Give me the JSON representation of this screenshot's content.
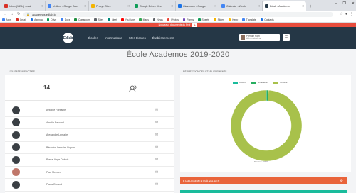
{
  "browser": {
    "tabs": [
      {
        "title": "Inbox (1,234) - mail",
        "color": "#d93025"
      },
      {
        "title": "Untitled - Google Docs",
        "color": "#4285f4"
      },
      {
        "title": "Proxy - Sites",
        "color": "#f4b400"
      },
      {
        "title": "Google Drive - files",
        "color": "#0f9d58"
      },
      {
        "title": "Classroom - Google",
        "color": "#1a73e8"
      },
      {
        "title": "Calendar - Week",
        "color": "#4285f4"
      },
      {
        "title": "Edlab - Academos",
        "color": "#253746"
      }
    ],
    "active_tab": 6,
    "new_tab_label": "+",
    "window_controls": [
      "–",
      "❐",
      "✕"
    ],
    "url": "academos.edlab.io",
    "bookmarks": [
      "Apps",
      "Gmail",
      "Agenda",
      "Drive",
      "Docs",
      "Classroom",
      "Sites",
      "Meet",
      "YouTube",
      "Maps",
      "News",
      "Photos",
      "Forms",
      "Sheets",
      "Slides",
      "Keep",
      "Translate",
      "Contacts"
    ]
  },
  "banner": {
    "text": "Nouveaux documents du Prof",
    "button": "+"
  },
  "app": {
    "logo": "Edlab",
    "nav": [
      "Écoles",
      "Informations",
      "Mes Écoles",
      "Établissements"
    ],
    "user_name": "Prénom Nom",
    "user_role": "Administrateur",
    "menu_icon": "☰"
  },
  "page_title": "École Academos 2019-2020",
  "left": {
    "section_label": "UTILISATEURS ACTIFS",
    "stat_value": "14",
    "users": [
      "Antoine Fontaine",
      "Amélie Bernard",
      "Alexandre Lemaire",
      "Bérénice Lemaire-Dupont",
      "Pierre-Ange Dubois",
      "Paul Mercier",
      "Paula Durand"
    ],
    "row_icon": "✉"
  },
  "right": {
    "section_label": "RÉPARTITION DES ÉTABLISSEMENTS",
    "legend": [
      {
        "label": "Ouvert",
        "color": "#1abc9c"
      },
      {
        "label": "En attente",
        "color": "#27ae60"
      },
      {
        "label": "Terminé",
        "color": "#a8c14b"
      }
    ],
    "caption": "Terminé: 100%",
    "orange_bar": "ÉTABLISSEMENTS À VALIDER",
    "orange_icon": "⚙"
  },
  "chart_data": {
    "type": "pie",
    "style": "donut",
    "categories": [
      "Ouvert",
      "En attente",
      "Terminé"
    ],
    "values": [
      0,
      1,
      99
    ],
    "colors": [
      "#1abc9c",
      "#27ae60",
      "#a8c14b"
    ]
  }
}
